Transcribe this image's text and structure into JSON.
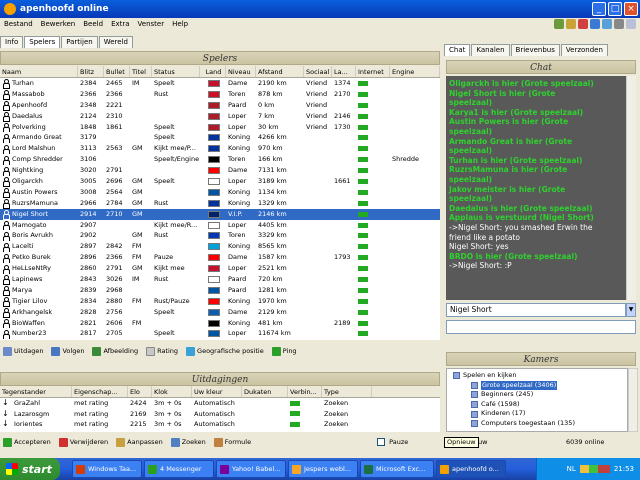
{
  "window": {
    "title": "apenhoofd online"
  },
  "menu": [
    "Bestand",
    "Bewerken",
    "Beeld",
    "Extra",
    "Venster",
    "Help"
  ],
  "left_tabs": [
    "Info",
    "Spelers",
    "Partijen",
    "Wereld"
  ],
  "players": {
    "header": "Spelers",
    "columns": [
      "Naam",
      "Blitz",
      "Bullet",
      "Titel",
      "Status",
      "Land",
      "Niveau",
      "Afstand",
      "Sociaal",
      "La...",
      "Internet",
      "Engine"
    ],
    "rows": [
      {
        "name": "Turhan",
        "blitz": "2384",
        "bullet": "2465",
        "title": "IM",
        "status": "Speelt",
        "niveau": "Dame",
        "afstand": "2190 km",
        "sociaal": "Vriend",
        "la": "1374",
        "flag": "#c8102e"
      },
      {
        "name": "Massabob",
        "blitz": "2366",
        "bullet": "2366",
        "title": "",
        "status": "Rust",
        "niveau": "Toren",
        "afstand": "878 km",
        "sociaal": "Vriend",
        "la": "2170",
        "flag": "#ce1126"
      },
      {
        "name": "Apenhoofd",
        "blitz": "2348",
        "bullet": "2221",
        "title": "",
        "status": "",
        "niveau": "Paard",
        "afstand": "0 km",
        "sociaal": "Vriend",
        "la": "",
        "flag": "#ae1c28"
      },
      {
        "name": "Daedalus",
        "blitz": "2124",
        "bullet": "2310",
        "title": "",
        "status": "",
        "niveau": "Loper",
        "afstand": "7 km",
        "sociaal": "Vriend",
        "la": "2146",
        "flag": "#ae1c28"
      },
      {
        "name": "Polverking",
        "blitz": "1848",
        "bullet": "1861",
        "title": "",
        "status": "Speelt",
        "niveau": "Loper",
        "afstand": "30 km",
        "sociaal": "Vriend",
        "la": "1730",
        "flag": "#ae1c28"
      },
      {
        "name": "Armando Great",
        "blitz": "3179",
        "bullet": "",
        "title": "",
        "status": "Speelt",
        "niveau": "Koning",
        "afstand": "4266 km",
        "sociaal": "",
        "la": "",
        "flag": "#0033a0"
      },
      {
        "name": "Lord Malshun",
        "blitz": "3113",
        "bullet": "2563",
        "title": "GM",
        "status": "Kijkt mee/P...",
        "niveau": "Koning",
        "afstand": "970 km",
        "sociaal": "",
        "la": "",
        "flag": "#0033a0"
      },
      {
        "name": "Comp Shredder",
        "blitz": "3106",
        "bullet": "",
        "title": "",
        "status": "Speelt/Engine",
        "niveau": "Toren",
        "afstand": "166 km",
        "sociaal": "",
        "la": "",
        "flag": "#000000"
      },
      {
        "name": "Nightking",
        "blitz": "3020",
        "bullet": "2791",
        "title": "",
        "status": "",
        "niveau": "Dame",
        "afstand": "7131 km",
        "sociaal": "",
        "la": "",
        "flag": "#ff0000"
      },
      {
        "name": "Oligarckh",
        "blitz": "3005",
        "bullet": "2696",
        "title": "GM",
        "status": "Speelt",
        "niveau": "Loper",
        "afstand": "3189 km",
        "sociaal": "",
        "la": "1661",
        "flag": "#ffffff"
      },
      {
        "name": "Austin Powers",
        "blitz": "3008",
        "bullet": "2564",
        "title": "GM",
        "status": "",
        "niveau": "Koning",
        "afstand": "1134 km",
        "sociaal": "",
        "la": "",
        "flag": "#0055a4"
      },
      {
        "name": "RuzrsMamuna",
        "blitz": "2966",
        "bullet": "2784",
        "title": "GM",
        "status": "Rust",
        "niveau": "Koning",
        "afstand": "1329 km",
        "sociaal": "",
        "la": "",
        "flag": "#0033a0"
      },
      {
        "name": "Nigel Short",
        "blitz": "2914",
        "bullet": "2710",
        "title": "GM",
        "status": "",
        "niveau": "V.I.P.",
        "afstand": "2146 km",
        "sociaal": "",
        "la": "",
        "flag": "#012169",
        "selected": true
      },
      {
        "name": "Mamogato",
        "blitz": "2907",
        "bullet": "",
        "title": "",
        "status": "Kijkt mee/R...",
        "niveau": "Loper",
        "afstand": "4405 km",
        "sociaal": "",
        "la": "",
        "flag": "#ffffff"
      },
      {
        "name": "Boris Avrukh",
        "blitz": "2902",
        "bullet": "",
        "title": "GM",
        "status": "Rust",
        "niveau": "Toren",
        "afstand": "3329 km",
        "sociaal": "",
        "la": "",
        "flag": "#0038b8"
      },
      {
        "name": "Lacelti",
        "blitz": "2897",
        "bullet": "2842",
        "title": "FM",
        "status": "",
        "niveau": "Koning",
        "afstand": "8565 km",
        "sociaal": "",
        "la": "",
        "flag": "#00a3dd"
      },
      {
        "name": "Petko Burek",
        "blitz": "2896",
        "bullet": "2366",
        "title": "FM",
        "status": "Pauze",
        "niveau": "Dame",
        "afstand": "1587 km",
        "sociaal": "",
        "la": "1793",
        "flag": "#ff0000"
      },
      {
        "name": "HeLLseNtRy",
        "blitz": "2860",
        "bullet": "2791",
        "title": "GM",
        "status": "Kijkt mee",
        "niveau": "Loper",
        "afstand": "2521 km",
        "sociaal": "",
        "la": "",
        "flag": "#c8102e"
      },
      {
        "name": "Lapinews",
        "blitz": "2843",
        "bullet": "3026",
        "title": "IM",
        "status": "Rust",
        "niveau": "Paard",
        "afstand": "720 km",
        "sociaal": "",
        "la": "",
        "flag": "#ffffff"
      },
      {
        "name": "Marya",
        "blitz": "2839",
        "bullet": "2968",
        "title": "",
        "status": "",
        "niveau": "Paard",
        "afstand": "1281 km",
        "sociaal": "",
        "la": "",
        "flag": "#0055a4"
      },
      {
        "name": "Tigier Lilov",
        "blitz": "2834",
        "bullet": "2880",
        "title": "FM",
        "status": "Rust/Pauze",
        "niveau": "Koning",
        "afstand": "1970 km",
        "sociaal": "",
        "la": "",
        "flag": "#ff0000"
      },
      {
        "name": "Arkhangelsk",
        "blitz": "2828",
        "bullet": "2756",
        "title": "",
        "status": "Speelt",
        "niveau": "Dame",
        "afstand": "2129 km",
        "sociaal": "",
        "la": "",
        "flag": "#0d5eaf"
      },
      {
        "name": "BioWaffen",
        "blitz": "2821",
        "bullet": "2606",
        "title": "FM",
        "status": "",
        "niveau": "Koning",
        "afstand": "481 km",
        "sociaal": "",
        "la": "2189",
        "flag": "#000000"
      },
      {
        "name": "Number23",
        "blitz": "2817",
        "bullet": "2705",
        "title": "",
        "status": "Speelt",
        "niveau": "Loper",
        "afstand": "11674 km",
        "sociaal": "",
        "la": "",
        "flag": "#0055a4"
      }
    ],
    "engine_value": "Shredde",
    "toolbar": [
      "Uitdagen",
      "Volgen",
      "Afbeelding",
      "Rating",
      "Geografische positie",
      "Ping"
    ]
  },
  "challenges": {
    "header": "Uitdagingen",
    "columns": [
      "Tegenstander",
      "Eigenschap...",
      "Elo",
      "Klok",
      "Uw kleur",
      "Dukaten",
      "Verbin...",
      "Type"
    ],
    "rows": [
      {
        "opponent": "GraZahl",
        "prop": "met rating",
        "elo": "2424",
        "clock": "3m + 0s",
        "color": "Automatisch",
        "type": "Zoeken"
      },
      {
        "opponent": "Lazarosgm",
        "prop": "met rating",
        "elo": "2169",
        "clock": "3m + 0s",
        "color": "Automatisch",
        "type": "Zoeken"
      },
      {
        "opponent": "Iorientes",
        "prop": "met rating",
        "elo": "2215",
        "clock": "3m + 0s",
        "color": "Automatisch",
        "type": "Zoeken"
      }
    ],
    "toolbar": [
      "Accepteren",
      "Verwijderen",
      "Aanpassen",
      "Zoeken",
      "Formule"
    ],
    "pause_label": "Pauze"
  },
  "right_tabs": [
    "Chat",
    "Kanalen",
    "Brievenbus",
    "Verzonden"
  ],
  "chat": {
    "header": "Chat",
    "lines": [
      {
        "text": "Oligarckh is hier (Grote speelzaal)",
        "white": false
      },
      {
        "text": "Nigel Short is hier (Grote",
        "white": false
      },
      {
        "text": "speelzaal)",
        "white": false
      },
      {
        "text": "Karya1 is hier (Grote speelzaal)",
        "white": false
      },
      {
        "text": "Austin Powers is hier (Grote",
        "white": false
      },
      {
        "text": "speelzaal)",
        "white": false
      },
      {
        "text": "Armando Great is hier (Grote",
        "white": false
      },
      {
        "text": "speelzaal)",
        "white": false
      },
      {
        "text": "Turhan is hier (Grote speelzaal)",
        "white": false
      },
      {
        "text": "RuzrsMamuna is hier (Grote",
        "white": false
      },
      {
        "text": "speelzaal)",
        "white": false
      },
      {
        "text": "Jakov meister is hier (Grote",
        "white": false
      },
      {
        "text": "speelzaal)",
        "white": false
      },
      {
        "text": "Daedalus is hier (Grote speelzaal)",
        "white": false
      },
      {
        "text": "Applaus is verstuurd (Nigel Short)",
        "white": false
      },
      {
        "text": "->Nigel Short: you smashed Erwin the",
        "white": true
      },
      {
        "text": "friend like a potato",
        "white": true
      },
      {
        "text": "Nigel Short:  yes",
        "white": true
      },
      {
        "text": "BRDO is hier (Grote speelzaal)",
        "white": false
      },
      {
        "text": "->Nigel Short: :P",
        "white": true
      }
    ],
    "recipient": "Nigel Short"
  },
  "rooms": {
    "header": "Kamers",
    "items": [
      {
        "label": "Spelen en kijken",
        "indent": 0,
        "selected": false
      },
      {
        "label": "Grote speelzaal (3406)",
        "indent": 1,
        "selected": true
      },
      {
        "label": "Beginners (245)",
        "indent": 1,
        "selected": false
      },
      {
        "label": "Café (1598)",
        "indent": 1,
        "selected": false
      },
      {
        "label": "Kinderen (17)",
        "indent": 1,
        "selected": false
      },
      {
        "label": "Computers toegestaan (135)",
        "indent": 1,
        "selected": false
      }
    ]
  },
  "status": {
    "online": "6039 online",
    "tooltip": "Opnieuw",
    "tooltip_rest": "uw"
  },
  "taskbar": {
    "start": "start",
    "tasks": [
      {
        "label": "Windows Taa...",
        "color": "#d83b01"
      },
      {
        "label": "4 Messenger",
        "color": "#2ca01c"
      },
      {
        "label": "Yahoo! Babel...",
        "color": "#7b0099"
      },
      {
        "label": "Jespers webl...",
        "color": "#f5a623"
      },
      {
        "label": "Microsoft Exc...",
        "color": "#1d6f42"
      },
      {
        "label": "apenhoofd o...",
        "color": "#f4a000"
      }
    ],
    "lang": "NL",
    "clock": "21:53"
  }
}
